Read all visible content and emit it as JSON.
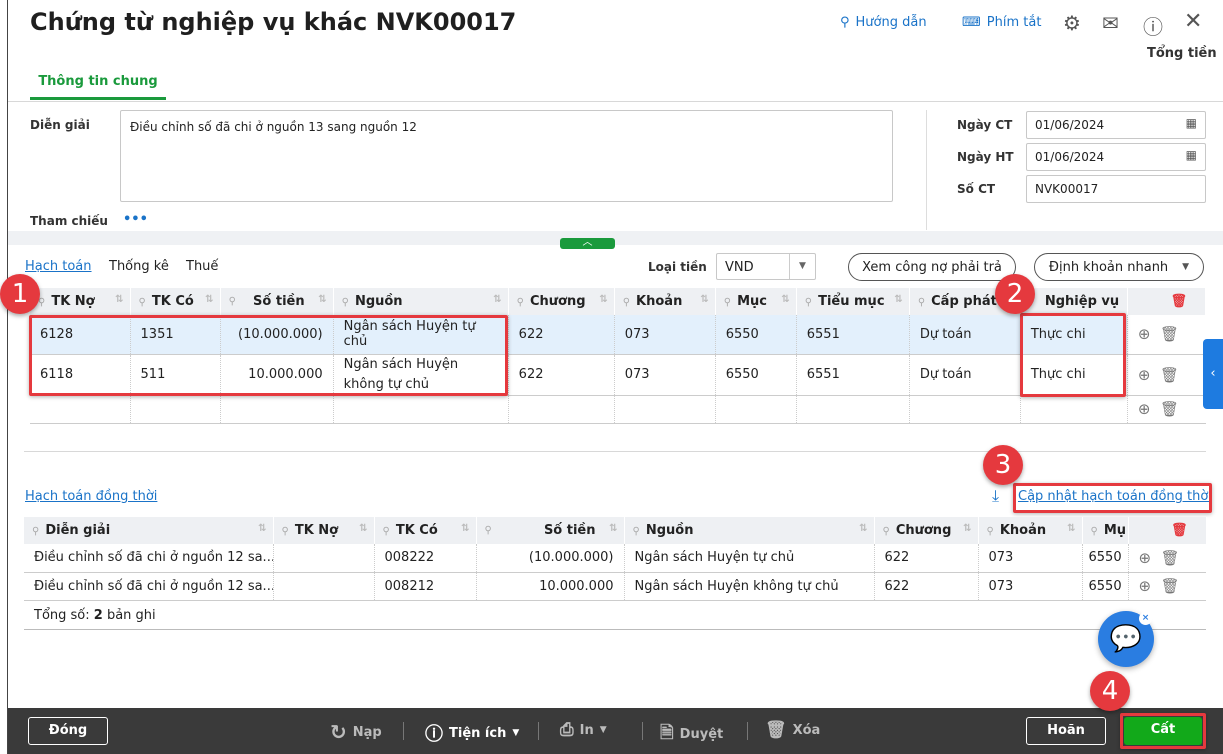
{
  "window": {
    "title": "Chứng từ nghiệp vụ khác NVK00017",
    "help_label": "Hướng dẫn",
    "shortcut_label": "Phím tắt",
    "total_label": "Tổng tiền"
  },
  "tabs": {
    "general": "Thông tin chung"
  },
  "form": {
    "description_label": "Diễn giải",
    "description_value": "Điều chỉnh số đã chi ở  nguồn 13 sang nguồn 12",
    "reference_label": "Tham chiếu",
    "reference_more": "•••",
    "doc_date_label": "Ngày CT",
    "doc_date_value": "01/06/2024",
    "post_date_label": "Ngày HT",
    "post_date_value": "01/06/2024",
    "doc_no_label": "Số CT",
    "doc_no_value": "NVK00017"
  },
  "detail_tabs": [
    "Hạch toán",
    "Thống kê",
    "Thuế"
  ],
  "currency": {
    "label": "Loại tiền",
    "value": "VND"
  },
  "buttons": {
    "view_payables": "Xem công nợ phải trả",
    "quick_entry": "Định khoản nhanh"
  },
  "main_table": {
    "columns": [
      "TK Nợ",
      "TK Có",
      "Số tiền",
      "Nguồn",
      "Chương",
      "Khoản",
      "Mục",
      "Tiểu mục",
      "Cấp phát",
      "Nghiệp vụ"
    ],
    "rows": [
      [
        "6128",
        "1351",
        "(10.000.000)",
        "Ngân sách Huyện tự chủ",
        "622",
        "073",
        "6550",
        "6551",
        "Dự toán",
        "Thực chi"
      ],
      [
        "6118",
        "511",
        "10.000.000",
        "Ngân sách Huyện không tự chủ",
        "622",
        "073",
        "6550",
        "6551",
        "Dự toán",
        "Thực chi"
      ]
    ]
  },
  "simultaneous": {
    "title": "Hạch toán đồng thời",
    "update_link": "Cập nhật hạch toán đồng thời",
    "columns": [
      "Diễn giải",
      "TK Nợ",
      "TK Có",
      "Số tiền",
      "Nguồn",
      "Chương",
      "Khoản",
      "Mụ"
    ],
    "rows": [
      [
        "Điều chỉnh số đã chi ở nguồn 12 sa...",
        "",
        "008222",
        "(10.000.000)",
        "Ngân sách Huyện tự chủ",
        "622",
        "073",
        "6550"
      ],
      [
        "Điều chỉnh số đã chi ở nguồn 12 sa...",
        "",
        "008212",
        "10.000.000",
        "Ngân sách Huyện không tự chủ",
        "622",
        "073",
        "6550"
      ]
    ],
    "total_prefix": "Tổng số: ",
    "total_count": "2",
    "total_suffix": " bản ghi"
  },
  "annotations": [
    "1",
    "2",
    "3",
    "4"
  ],
  "footer": {
    "close": "Đóng",
    "reload": "Nạp",
    "utilities": "Tiện ích",
    "print": "In",
    "approve": "Duyệt",
    "delete": "Xóa",
    "defer": "Hoãn",
    "save": "Cất"
  },
  "colors": {
    "accent_green": "#1a9a3c",
    "link_blue": "#1a73c8",
    "annotation_red": "#e5393e",
    "footer_bg": "#3a3a3a"
  }
}
